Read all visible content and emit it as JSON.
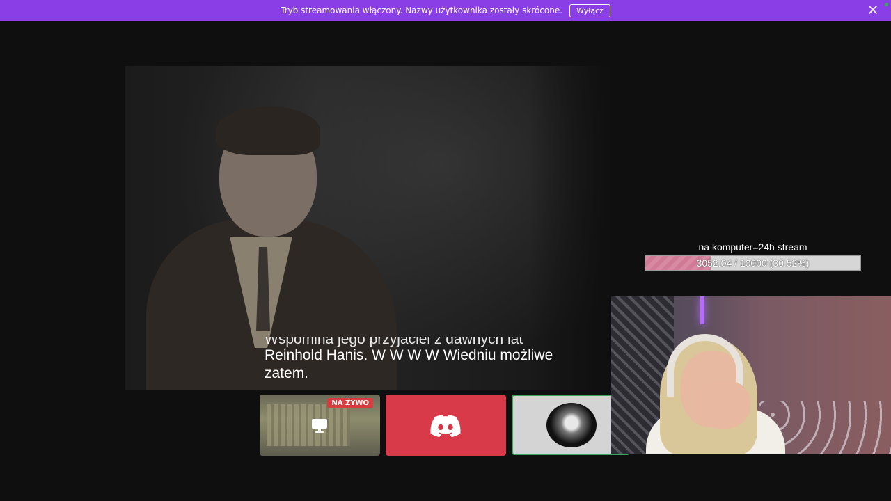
{
  "banner": {
    "message": "Tryb streamowania włączony. Nazwy użytkownika zostały skrócone.",
    "disable_label": "Wyłącz",
    "close_icon": "close-icon",
    "background": "#8a3ee6"
  },
  "video": {
    "subtitle_cut": "Wspomina jego przyjaciel z dawnych lat",
    "subtitle_line1": "Reinhold Hanis. W W W W Wiedniu możliwe",
    "subtitle_line2": "zatem."
  },
  "goal": {
    "title": "na komputer=24h stream",
    "current": 3052.04,
    "target": 10000,
    "percent": 30.52,
    "text": "3052.04 / 10000 (30.52%)"
  },
  "tiles": {
    "live_badge": "NA ŻYWO",
    "live_icon": "screen-share-icon",
    "discord_icon": "discord-icon",
    "discord_color": "#d93a4a",
    "avatar_border": "#3ba55d"
  }
}
